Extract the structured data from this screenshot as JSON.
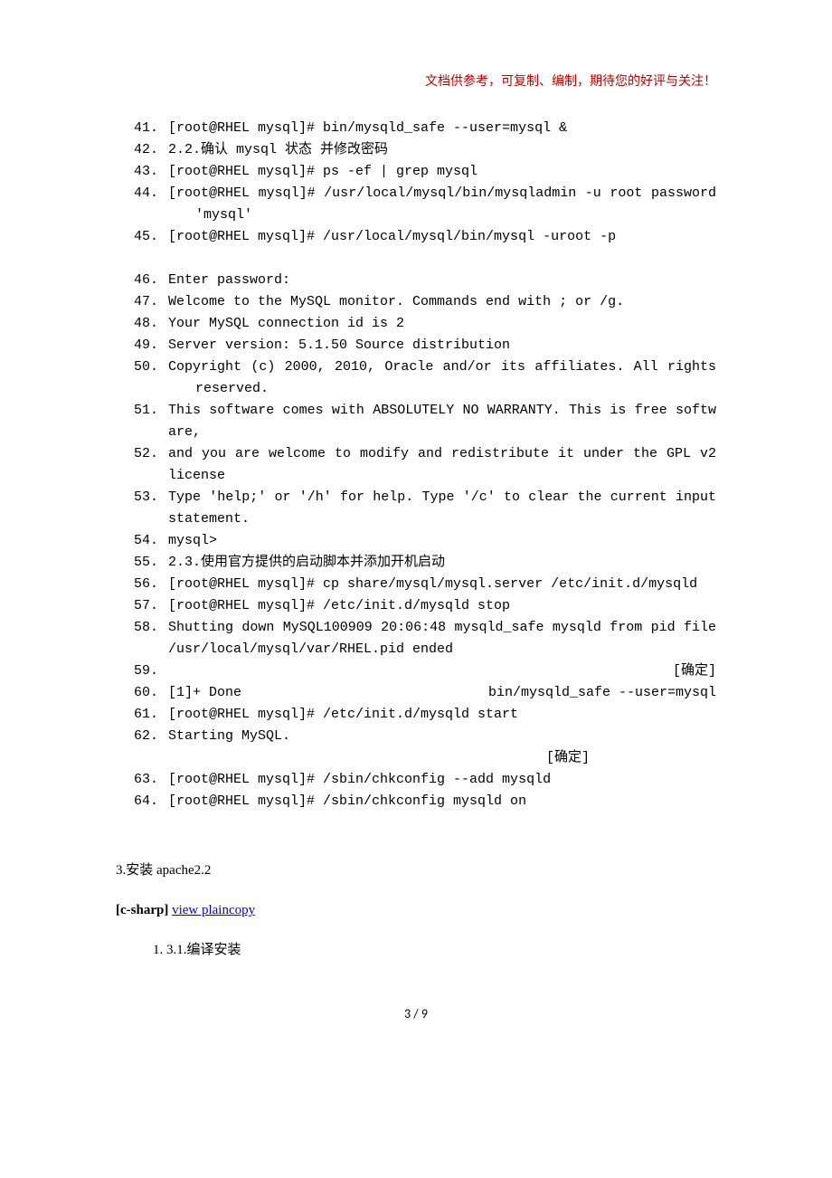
{
  "header_note": "文档供参考，可复制、编制，期待您的好评与关注！",
  "code_start": 41,
  "code": {
    "l41": "[root@RHEL  mysql]#  bin/mysqld_safe  --user=mysql  &",
    "l42": "2.2.确认 mysql 状态  并修改密码",
    "l43": "[root@RHEL  mysql]#  ps  -ef  |  grep  mysql",
    "l44": "[root@RHEL  mysql]#  /usr/local/mysql/bin/mysqladmin  -u  root  password  'mysql'",
    "l45": "[root@RHEL  mysql]#  /usr/local/mysql/bin/mysql  -uroot  -p    ",
    "l46": "Enter  password:",
    "l47": "Welcome  to  the  MySQL  monitor.    Commands  end  with  ;  or  /g.",
    "l48": "Your  MySQL  connection  id  is  2",
    "l49": "Server  version:  5.1.50  Source  distribution",
    "l50": "Copyright  (c)  2000,  2010,  Oracle and/or  its  affiliates.   All  rights  reserved.",
    "l51": "This  software  comes  with  ABSOLUTELY  NO  WARRANTY.  This  is  free  software,",
    "l52": "and  you  are  welcome  to  modify  and  redistribute  it  under  the  GPL  v2  license",
    "l53": "Type  'help;'  or  '/h'  for  help.  Type  '/c'  to  clear  the  current  input  statement.",
    "l54": "mysql>",
    "l55": "2.3.使用官方提供的启动脚本并添加开机启动",
    "l56": "[root@RHEL  mysql]#  cp  share/mysql/mysql.server  /etc/init.d/mysqld",
    "l57": "[root@RHEL  mysql]#  /etc/init.d/mysqld  stop",
    "l58": "Shutting  down  MySQL100909  20:06:48  mysqld_safe  mysqld  from  pid  file  /usr/local/mysql/var/RHEL.pid  ended",
    "l59": "                                                       [确定]",
    "l60_a": "[1]+    Done",
    "l60_b": "bin/mysqld_safe  --user=mysql",
    "l61": "[root@RHEL  mysql]#  /etc/init.d/mysqld  start",
    "l62_a": "Starting  MySQL.",
    "l62_b": "[确定]",
    "l63": "[root@RHEL  mysql]#  /sbin/chkconfig  --add  mysqld",
    "l64": "[root@RHEL  mysql]#  /sbin/chkconfig  mysqld  on"
  },
  "section3_title": "3.安装 apache2.2",
  "lang_tag": "[c-sharp]",
  "link_text": "view plaincopy",
  "sub_item": "3.1.编译安装",
  "page_number": "3 / 9"
}
